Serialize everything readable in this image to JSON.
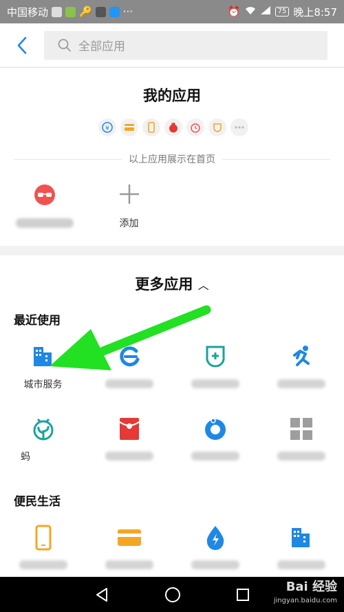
{
  "status_bar": {
    "carrier": "中国移动",
    "battery": "75",
    "time": "晚上8:57"
  },
  "header": {
    "search_placeholder": "全部应用"
  },
  "my_apps": {
    "title": "我的应用",
    "mini_icons": [
      "yuan-icon",
      "card-icon",
      "phone-icon",
      "money-bag-icon",
      "alarm-icon",
      "cup-icon",
      "more-icon"
    ],
    "note": "以上应用展示在首页",
    "items": [
      {
        "label": "",
        "icon": "glasses-icon"
      },
      {
        "label": "添加",
        "icon": "plus-icon"
      }
    ]
  },
  "more_apps": {
    "title": "更多应用",
    "sections": [
      {
        "label": "最近使用",
        "items": [
          {
            "label": "城市服务",
            "icon": "city-icon",
            "color": "#1e88e5"
          },
          {
            "label": "",
            "icon": "e-icon",
            "color": "#1e88e5"
          },
          {
            "label": "",
            "icon": "medical-shield-icon",
            "color": "#1aa39a"
          },
          {
            "label": "",
            "icon": "running-icon",
            "color": "#1e88e5"
          },
          {
            "label": "蚂",
            "icon": "sprout-icon",
            "color": "#1aa39a"
          },
          {
            "label": "",
            "icon": "red-envelope-icon",
            "color": "#e53935"
          },
          {
            "label": "",
            "icon": "blue-circle-icon",
            "color": "#1e88e5"
          },
          {
            "label": "",
            "icon": "grid-squares-icon",
            "color": "#9e9e9e"
          }
        ]
      },
      {
        "label": "便民生活",
        "items": [
          {
            "label": "",
            "icon": "phone-icon",
            "color": "#f5a623"
          },
          {
            "label": "",
            "icon": "credit-card-icon",
            "color": "#f5a623"
          },
          {
            "label": "",
            "icon": "water-bolt-icon",
            "color": "#1e88e5"
          },
          {
            "label": "",
            "icon": "city-icon",
            "color": "#1e88e5"
          }
        ]
      }
    ]
  },
  "watermark": {
    "brand": "Bai 经验",
    "url": "jingyan.baidu.com"
  }
}
